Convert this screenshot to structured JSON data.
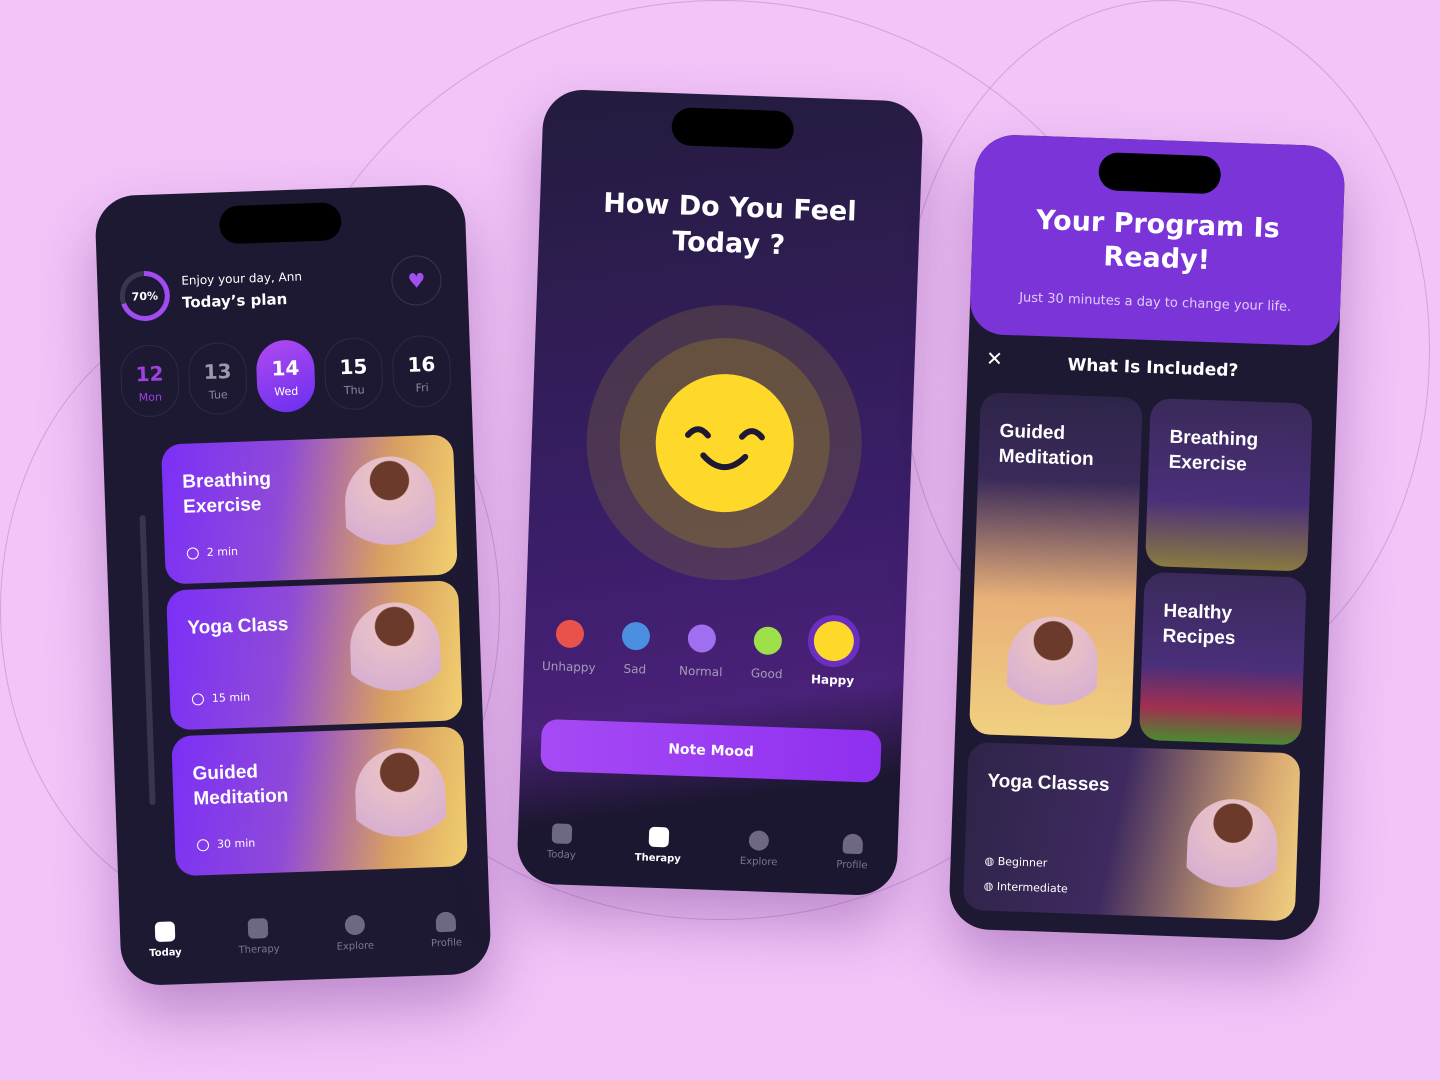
{
  "left_phone": {
    "progress_percent": 70,
    "progress_label": "70%",
    "greeting": "Enjoy your day, Ann",
    "title": "Today’s plan",
    "days": [
      {
        "num": "12",
        "name": "Mon"
      },
      {
        "num": "13",
        "name": "Tue"
      },
      {
        "num": "14",
        "name": "Wed",
        "selected": true
      },
      {
        "num": "15",
        "name": "Thu"
      },
      {
        "num": "16",
        "name": "Fri"
      }
    ],
    "cards": [
      {
        "title": "Breathing Exercise",
        "duration": "2 min"
      },
      {
        "title": "Yoga Class",
        "duration": "15 min"
      },
      {
        "title": "Guided Meditation",
        "duration": "30 min"
      }
    ],
    "nav": [
      {
        "label": "Today",
        "active": true
      },
      {
        "label": "Therapy"
      },
      {
        "label": "Explore"
      },
      {
        "label": "Profile"
      }
    ]
  },
  "middle_phone": {
    "title": "How Do You Feel Today ?",
    "moods": [
      {
        "label": "Unhappy",
        "color": "#e9524a"
      },
      {
        "label": "Sad",
        "color": "#4b8fe0"
      },
      {
        "label": "Normal",
        "color": "#a06ef0"
      },
      {
        "label": "Good",
        "color": "#9ee04a"
      },
      {
        "label": "Happy",
        "color": "#ffd92a",
        "selected": true
      }
    ],
    "button": "Note Mood",
    "nav": [
      {
        "label": "Today"
      },
      {
        "label": "Therapy",
        "active": true
      },
      {
        "label": "Explore"
      },
      {
        "label": "Profile"
      }
    ]
  },
  "right_phone": {
    "title": "Your Program Is Ready!",
    "subtitle": "Just 30 minutes a day to change your life.",
    "section": "What Is Included?",
    "items": [
      "Guided Meditation",
      "Breathing Exercise",
      "Healthy Recipes",
      "Yoga Classes"
    ],
    "levels": [
      "Beginner",
      "Intermediate"
    ]
  },
  "colors": {
    "background": "#f2c4f8",
    "phone": "#1e1933",
    "accent": "#8a3df5",
    "smiley": "#ffd92a"
  }
}
